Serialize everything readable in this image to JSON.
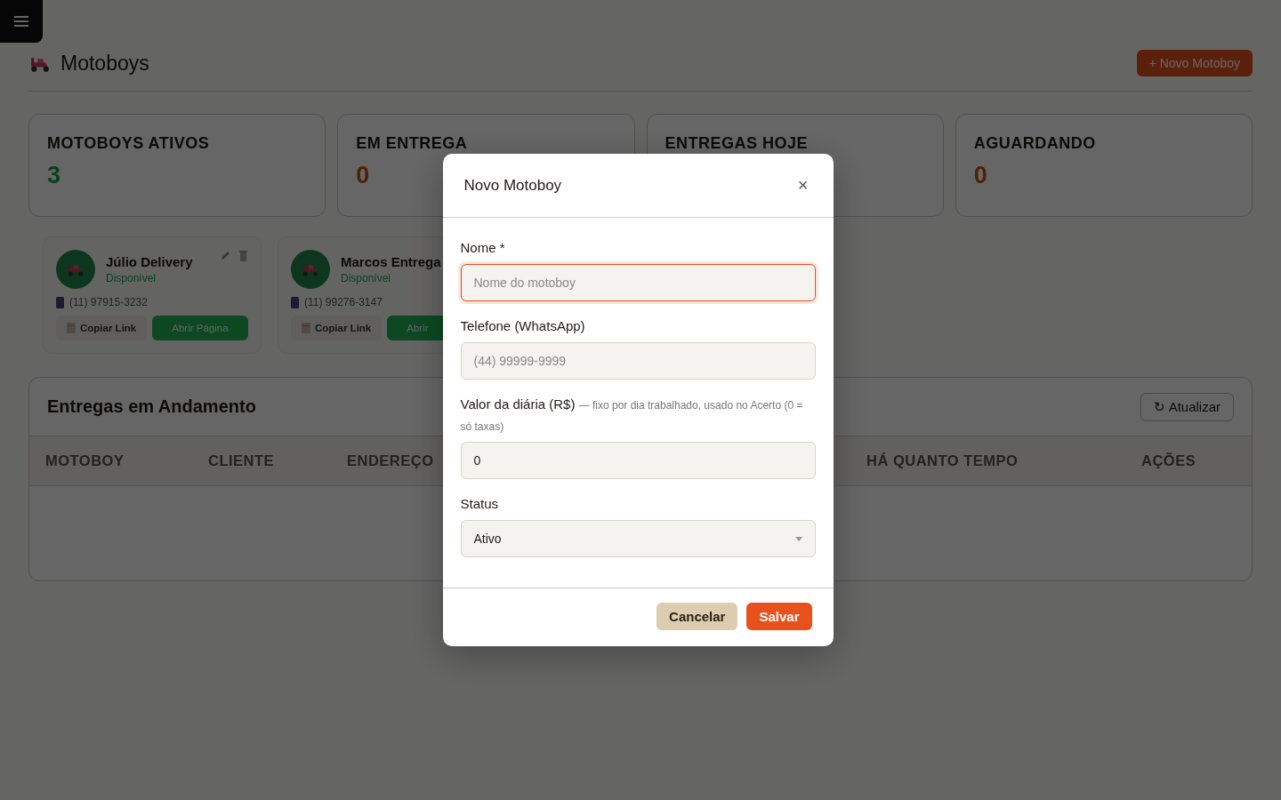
{
  "page": {
    "title": "Motoboys",
    "new_button": "+ Novo Motoboy"
  },
  "stats": [
    {
      "label": "MOTOBOYS ATIVOS",
      "value": "3",
      "kind": "active"
    },
    {
      "label": "EM ENTREGA",
      "value": "0",
      "kind": "warn"
    },
    {
      "label": "ENTREGAS HOJE"
    },
    {
      "label": "AGUARDANDO",
      "value": "0",
      "kind": "warn"
    }
  ],
  "motoboys": [
    {
      "name": "Júlio Delivery",
      "status": "Disponível",
      "phone": "(11) 97915-3232",
      "copy_button": "Copiar Link",
      "open_button": "Abrir Página",
      "tools_visible": true
    },
    {
      "name": "Marcos Entrega",
      "status": "Disponível",
      "phone": "(11) 99276-3147",
      "copy_button": "Copiar Link",
      "open_button": "Abrir",
      "tools_visible": false
    }
  ],
  "deliveries": {
    "title": "Entregas em Andamento",
    "refresh_button": "↻ Atualizar",
    "columns": [
      "MOTOBOY",
      "CLIENTE",
      "ENDEREÇO",
      "HÁ QUANTO TEMPO",
      "AÇÕES"
    ]
  },
  "dialog": {
    "title": "Novo Motoboy",
    "close": "×",
    "fields": [
      {
        "kind": "text",
        "label": "Nome *",
        "placeholder": "Nome do motoboy",
        "focused": true
      },
      {
        "kind": "text",
        "label": "Telefone (WhatsApp)",
        "placeholder": "(44) 99999-9999",
        "focused": false
      },
      {
        "kind": "text",
        "label": "Valor da diária (R$)",
        "hint": "— fixo por dia trabalhado, usado no Acerto (0 = só taxas)",
        "value": "0",
        "focused": false
      },
      {
        "kind": "select",
        "label": "Status",
        "value": "Ativo",
        "focused": false
      }
    ],
    "buttons": [
      {
        "label": "Cancelar",
        "kind": "secondary"
      },
      {
        "label": "Salvar",
        "kind": "primary"
      }
    ]
  }
}
